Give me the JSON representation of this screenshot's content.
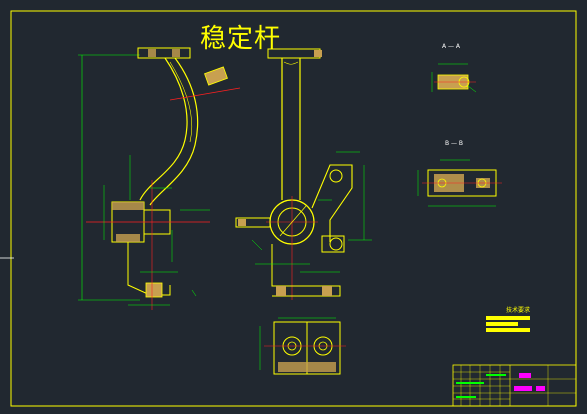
{
  "drawing": {
    "title": "稳定杆",
    "section_aa": "A — A",
    "section_bb": "B — B",
    "tech_requirements_heading": "技术要求"
  },
  "colors": {
    "background": "#212830",
    "part_outline": "#ffff00",
    "dimension": "#00ff00",
    "center_line": "#ff2020",
    "hatch": "#c8a050",
    "highlight": "#ff00ff",
    "border": "#ffff00"
  },
  "icons": {
    "title_block": "title-block-grid-icon"
  }
}
